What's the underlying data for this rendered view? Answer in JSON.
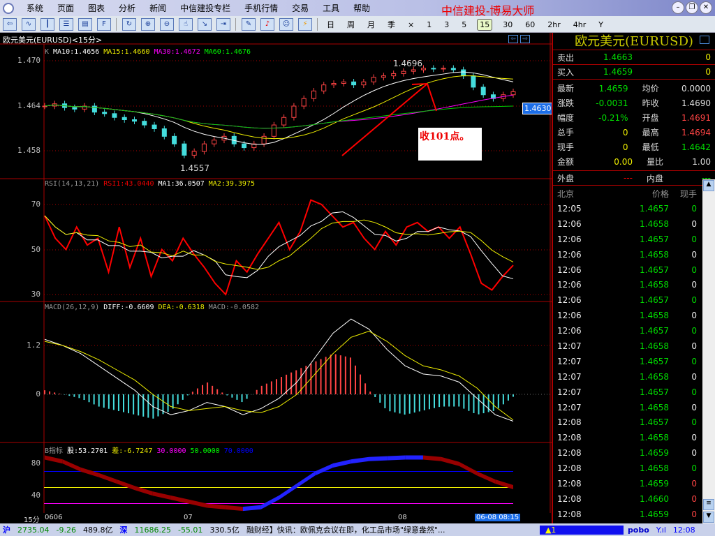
{
  "menu": {
    "items": [
      "系统",
      "页面",
      "图表",
      "分析",
      "新闻",
      "中信建投专栏",
      "手机行情",
      "交易",
      "工具",
      "帮助"
    ],
    "brand": "中信建投-博易大师"
  },
  "toolbar": {
    "periods": [
      "日",
      "周",
      "月",
      "季",
      "×",
      "1",
      "3",
      "5",
      "15",
      "30",
      "60",
      "2hr",
      "4hr",
      "Y"
    ],
    "selected_period": "15"
  },
  "chart": {
    "title": "欧元美元(EURUSD)<15分>",
    "price_legend": {
      "k": "K",
      "ma10": "MA10:1.4656",
      "ma15": "MA15:1.4660",
      "ma30": "MA30:1.4672",
      "ma60": "MA60:1.4676"
    },
    "rsi_legend": {
      "name": "RSI(14,13,21)",
      "rsi1": "RSI1:43.0440",
      "ma1": "MA1:36.0507",
      "ma2": "MA2:39.3975"
    },
    "macd_legend": {
      "name": "MACD(26,12,9)",
      "diff": "DIFF:-0.6609",
      "dea": "DEA:-0.6318",
      "macd": "MACD:-0.0582"
    },
    "b_legend": {
      "name": "B指标",
      "gu": "股:53.2701",
      "cha": "差:-6.7247",
      "l30": "30.0000",
      "l50": "50.0000",
      "l70": "70.0000"
    },
    "price_ticks": [
      "1.470",
      "1.464",
      "1.458"
    ],
    "rsi_ticks": [
      "70",
      "50",
      "30"
    ],
    "macd_ticks": [
      "1.2",
      "0"
    ],
    "b_ticks": [
      "80",
      "40"
    ],
    "high_label": "1.4696",
    "low_label": "1.4557",
    "current_price_tag": "1.4630",
    "annotation": "收101点。",
    "x_period": "15分",
    "x_labels": [
      "0606",
      "07",
      "08"
    ],
    "x_cursor": "06-08 08:15"
  },
  "chart_data": {
    "type": "line",
    "closes": [
      1.464,
      1.4643,
      1.4638,
      1.4636,
      1.464,
      1.4632,
      1.463,
      1.4625,
      1.4622,
      1.462,
      1.4615,
      1.461,
      1.46,
      1.459,
      1.4575,
      1.458,
      1.459,
      1.4595,
      1.46,
      1.459,
      1.4585,
      1.459,
      1.46,
      1.4615,
      1.4625,
      1.464,
      1.465,
      1.466,
      1.4668,
      1.467,
      1.4672,
      1.4668,
      1.4672,
      1.4678,
      1.468,
      1.4683,
      1.4686,
      1.4688,
      1.469,
      1.4689,
      1.469,
      1.4688,
      1.468,
      1.4665,
      1.4655,
      1.465,
      1.4655,
      1.4659
    ],
    "rsi": [
      65,
      55,
      50,
      60,
      52,
      55,
      40,
      60,
      42,
      55,
      38,
      50,
      45,
      55,
      48,
      42,
      35,
      30,
      45,
      40,
      48,
      55,
      62,
      50,
      58,
      72,
      70,
      65,
      60,
      62,
      55,
      50,
      58,
      52,
      60,
      62,
      58,
      60,
      55,
      60,
      48,
      35,
      32,
      38,
      43
    ],
    "macd_diff": [
      1.35,
      1.2,
      1.0,
      0.7,
      0.4,
      0.1,
      -0.3,
      -0.5,
      -0.4,
      -0.2,
      -0.3,
      -0.5,
      -0.35,
      -0.1,
      0.3,
      0.9,
      1.5,
      1.85,
      1.6,
      1.1,
      0.7,
      0.5,
      0.45,
      0.3,
      -0.1,
      -0.5,
      -0.66
    ],
    "macd_dea": [
      1.3,
      1.2,
      1.05,
      0.85,
      0.6,
      0.35,
      0.0,
      -0.3,
      -0.4,
      -0.35,
      -0.3,
      -0.4,
      -0.45,
      -0.3,
      0.0,
      0.5,
      1.0,
      1.4,
      1.55,
      1.3,
      0.95,
      0.7,
      0.6,
      0.45,
      0.15,
      -0.3,
      -0.63
    ],
    "b_gu": [
      90,
      85,
      75,
      68,
      60,
      52,
      45,
      40,
      35,
      30,
      28,
      26,
      28,
      40,
      55,
      70,
      80,
      85,
      88,
      89,
      90,
      90,
      88,
      82,
      70,
      60,
      53
    ],
    "b_lines": [
      30,
      50,
      70
    ],
    "ylim_price": [
      1.454,
      1.471
    ],
    "ylim_rsi": [
      25,
      80
    ],
    "ylim_macd": [
      -0.6,
      1.9
    ],
    "ylim_b": [
      20,
      100
    ]
  },
  "quote": {
    "title": "欧元美元(EURUSD)",
    "sell": {
      "label": "卖出",
      "price": "1.4663",
      "vol": "0"
    },
    "buy": {
      "label": "买入",
      "price": "1.4659",
      "vol": "0"
    },
    "rows": [
      {
        "k": "最新",
        "v": "1.4659",
        "vc": "#0d0",
        "k2": "均价",
        "v2": "0.0000",
        "v2c": "#ddd"
      },
      {
        "k": "涨跌",
        "v": "-0.0031",
        "vc": "#0d0",
        "k2": "昨收",
        "v2": "1.4690",
        "v2c": "#ddd"
      },
      {
        "k": "幅度",
        "v": "-0.21%",
        "vc": "#0d0",
        "k2": "开盘",
        "v2": "1.4691",
        "v2c": "#f44"
      },
      {
        "k": "总手",
        "v": "0",
        "vc": "#ee0",
        "k2": "最高",
        "v2": "1.4694",
        "v2c": "#f44"
      },
      {
        "k": "现手",
        "v": "0",
        "vc": "#ee0",
        "k2": "最低",
        "v2": "1.4642",
        "v2c": "#0d0"
      },
      {
        "k": "金额",
        "v": "0.00",
        "vc": "#ee0",
        "k2": "量比",
        "v2": "1.00",
        "v2c": "#ddd"
      }
    ],
    "outer": {
      "k": "外盘",
      "v": "---",
      "k2": "内盘",
      "v2": "---"
    },
    "ticks_header": [
      "北京",
      "价格",
      "现手"
    ],
    "ticks": [
      [
        "12:05",
        "1.4657",
        "0",
        "g"
      ],
      [
        "12:06",
        "1.4658",
        "0",
        "w"
      ],
      [
        "12:06",
        "1.4657",
        "0",
        "g"
      ],
      [
        "12:06",
        "1.4658",
        "0",
        "w"
      ],
      [
        "12:06",
        "1.4657",
        "0",
        "g"
      ],
      [
        "12:06",
        "1.4658",
        "0",
        "w"
      ],
      [
        "12:06",
        "1.4657",
        "0",
        "g"
      ],
      [
        "12:06",
        "1.4658",
        "0",
        "w"
      ],
      [
        "12:06",
        "1.4657",
        "0",
        "g"
      ],
      [
        "12:07",
        "1.4658",
        "0",
        "w"
      ],
      [
        "12:07",
        "1.4657",
        "0",
        "g"
      ],
      [
        "12:07",
        "1.4658",
        "0",
        "w"
      ],
      [
        "12:07",
        "1.4657",
        "0",
        "g"
      ],
      [
        "12:07",
        "1.4658",
        "0",
        "w"
      ],
      [
        "12:08",
        "1.4657",
        "0",
        "g"
      ],
      [
        "12:08",
        "1.4658",
        "0",
        "w"
      ],
      [
        "12:08",
        "1.4659",
        "0",
        "w"
      ],
      [
        "12:08",
        "1.4658",
        "0",
        "g"
      ],
      [
        "12:08",
        "1.4659",
        "0",
        "r"
      ],
      [
        "12:08",
        "1.4660",
        "0",
        "r"
      ],
      [
        "12:08",
        "1.4659",
        "0",
        "r"
      ]
    ]
  },
  "status": {
    "sh": "沪",
    "sh_idx": "2735.04",
    "sh_chg": "-9.26",
    "sh_amt": "489.8亿",
    "sz": "深",
    "sz_idx": "11686.25",
    "sz_chg": "-55.01",
    "sz_amt": "330.5亿",
    "news": "融财经】快讯：欧佩克会议在即，化工品市场\"绿意盎然\"...",
    "alert": "1",
    "pobo": "pobo",
    "time": "12:08"
  }
}
